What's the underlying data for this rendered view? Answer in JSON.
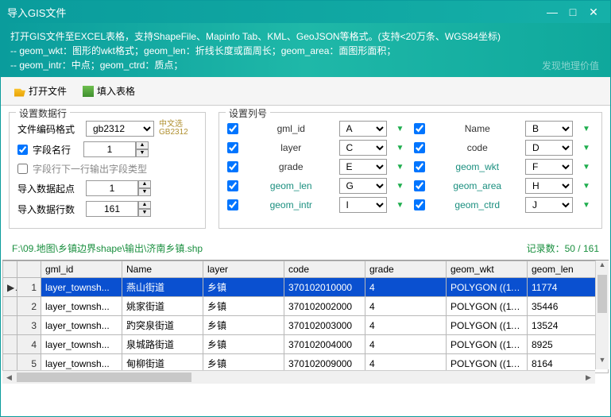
{
  "window": {
    "title": "导入GIS文件"
  },
  "banner": {
    "l1": "打开GIS文件至EXCEL表格，支持ShapeFile、Mapinfo Tab、KML、GeoJSON等格式。(支持<20万条、WGS84坐标)",
    "l2": "-- geom_wkt：图形的wkt格式；geom_len：折线长度或面周长；geom_area：面图形面积；",
    "l3": "-- geom_intr：中点；geom_ctrd：质点；",
    "watermark": "发现地理价值"
  },
  "toolbar": {
    "open": "打开文件",
    "fill": "填入表格"
  },
  "leftPanel": {
    "legend": "设置数据行",
    "encLabel": "文件编码格式",
    "encValue": "gb2312",
    "encHint1": "中文选",
    "encHint2": "GB2312",
    "fieldRow": "字段名行",
    "fieldRowVal": "1",
    "nextRowType": "字段行下一行输出字段类型",
    "startRow": "导入数据起点",
    "startRowVal": "1",
    "rowCount": "导入数据行数",
    "rowCountVal": "161"
  },
  "rightPanel": {
    "legend": "设置列号",
    "items": [
      {
        "name": "gml_id",
        "col": "A",
        "black": true
      },
      {
        "name": "Name",
        "col": "B",
        "black": true
      },
      {
        "name": "layer",
        "col": "C",
        "black": true
      },
      {
        "name": "code",
        "col": "D",
        "black": true
      },
      {
        "name": "grade",
        "col": "E",
        "black": true
      },
      {
        "name": "geom_wkt",
        "col": "F"
      },
      {
        "name": "geom_len",
        "col": "G"
      },
      {
        "name": "geom_area",
        "col": "H"
      },
      {
        "name": "geom_intr",
        "col": "I"
      },
      {
        "name": "geom_ctrd",
        "col": "J"
      }
    ]
  },
  "path": "F:\\09.地图\\乡镇边界shape\\输出\\济南乡镇.shp",
  "recordLabel": "记录数：",
  "recordVal": "50 / 161",
  "table": {
    "headers": [
      "gml_id",
      "Name",
      "layer",
      "code",
      "grade",
      "geom_wkt",
      "geom_len"
    ],
    "rows": [
      {
        "n": "1",
        "d": [
          "layer_townsh...",
          "燕山街道",
          "乡镇",
          "370102010000",
          "4",
          "POLYGON ((11...",
          "11774"
        ],
        "sel": true,
        "ptr": "▶"
      },
      {
        "n": "2",
        "d": [
          "layer_townsh...",
          "姚家街道",
          "乡镇",
          "370102002000",
          "4",
          "POLYGON ((11...",
          "35446"
        ]
      },
      {
        "n": "3",
        "d": [
          "layer_townsh...",
          "趵突泉街道",
          "乡镇",
          "370102003000",
          "4",
          "POLYGON ((11...",
          "13524"
        ]
      },
      {
        "n": "4",
        "d": [
          "layer_townsh...",
          "泉城路街道",
          "乡镇",
          "370102004000",
          "4",
          "POLYGON ((11...",
          "8925"
        ]
      },
      {
        "n": "5",
        "d": [
          "layer_townsh...",
          "甸柳街道",
          "乡镇",
          "370102009000",
          "4",
          "POLYGON ((11...",
          "8164"
        ]
      }
    ]
  }
}
